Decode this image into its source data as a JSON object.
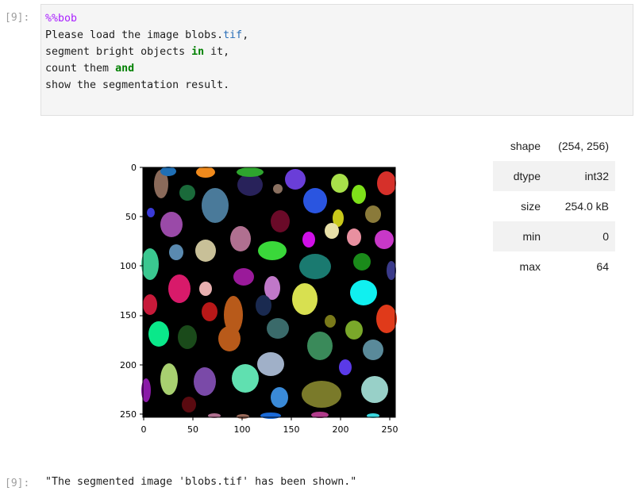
{
  "input_cell": {
    "prompt": "[9]:",
    "magic": "%%bob",
    "lines": {
      "l1_text": "Please load the image blobs.",
      "l1_ext": "tif",
      "l1_end": ",",
      "l2_text": "segment bright objects ",
      "l2_kw": "in",
      "l2_end": " it,",
      "l3_text": "count them ",
      "l3_kw": "and",
      "l4_text": "show the segmentation result."
    }
  },
  "plot": {
    "y_ticks": [
      "0",
      "50",
      "100",
      "150",
      "200",
      "250"
    ],
    "x_ticks": [
      "0",
      "50",
      "100",
      "150",
      "200",
      "250"
    ]
  },
  "stats": {
    "rows": [
      {
        "key": "shape",
        "value": "(254, 256)"
      },
      {
        "key": "dtype",
        "value": "int32"
      },
      {
        "key": "size",
        "value": "254.0 kB"
      },
      {
        "key": "min",
        "value": "0"
      },
      {
        "key": "max",
        "value": "64"
      }
    ]
  },
  "output_cell": {
    "prompt": "[9]:",
    "text": "\"The segmented image 'blobs.tif' has been shown.\""
  }
}
